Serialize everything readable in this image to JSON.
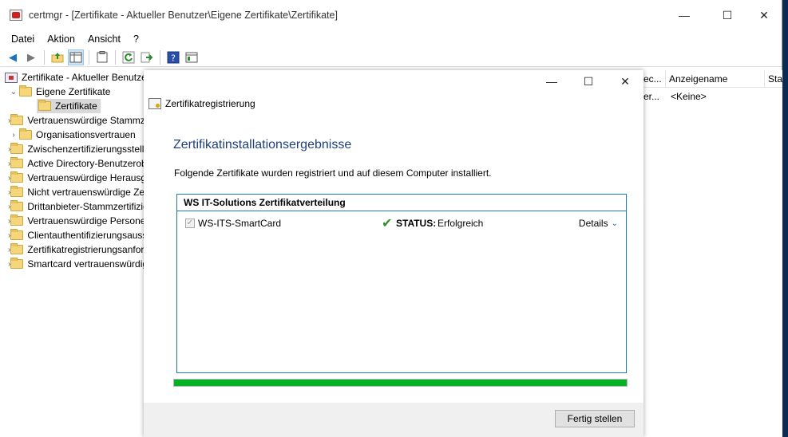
{
  "window": {
    "title": "certmgr - [Zertifikate - Aktueller Benutzer\\Eigene Zertifikate\\Zertifikate]",
    "minimize": "—",
    "maximize": "☐",
    "close": "✕"
  },
  "menu": [
    "Datei",
    "Aktion",
    "Ansicht",
    "?"
  ],
  "toolbar": {
    "icons": [
      "back-arrow-icon",
      "forward-arrow-icon",
      "up-folder-icon",
      "show-hide-tree-icon",
      "clipboard-icon",
      "refresh-icon",
      "export-list-icon",
      "help-icon",
      "properties-icon"
    ]
  },
  "tree": {
    "root": "Zertifikate - Aktueller Benutzer",
    "expanded": "Eigene Zertifikate",
    "selected": "Zertifikate",
    "items": [
      "Vertrauenswürdige Stammzertifizierungsstellen",
      "Organisationsvertrauen",
      "Zwischenzertifizierungsstellen",
      "Active Directory-Benutzerobjekt",
      "Vertrauenswürdige Herausgeber",
      "Nicht vertrauenswürdige Zertifikate",
      "Drittanbieter-Stammzertifizierungsstellen",
      "Vertrauenswürdige Personen",
      "Clientauthentifizierungsaussteller",
      "Zertifikatregistrierungsanforderungen",
      "Smartcard vertrauenswürdige Stämme"
    ]
  },
  "list": {
    "columns": [
      "ec...",
      "Anzeigename",
      "Sta"
    ],
    "rows": [
      [
        "er...",
        "<Keine>",
        ""
      ]
    ]
  },
  "dialog": {
    "minimize": "—",
    "maximize": "☐",
    "close": "✕",
    "header": "Zertifikatregistrierung",
    "title": "Zertifikatinstallationsergebnisse",
    "description": "Folgende Zertifikate wurden registriert und auf diesem Computer installiert.",
    "group_title": "WS IT-Solutions Zertifikatverteilung",
    "result": {
      "checked": "✓",
      "name": "WS-ITS-SmartCard",
      "status_icon": "✔",
      "status_label": "STATUS:",
      "status_value": "Erfolgreich",
      "details": "Details",
      "details_chevron": "⌄"
    },
    "progress_percent": 100,
    "progress_color": "#06b025",
    "finish_button": "Fertig stellen"
  }
}
